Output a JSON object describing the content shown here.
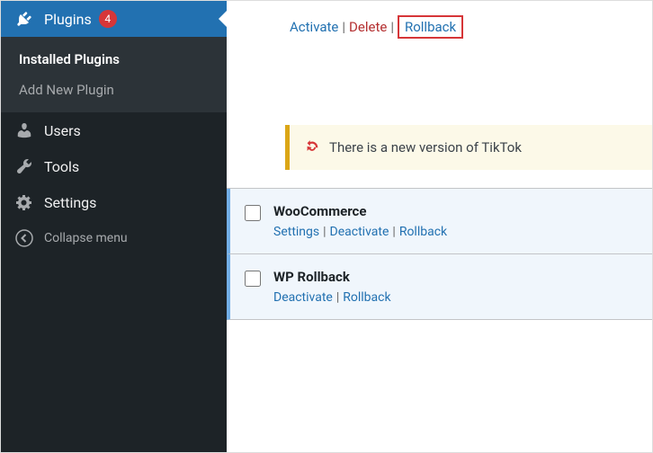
{
  "sidebar": {
    "plugins": {
      "label": "Plugins",
      "badge": "4"
    },
    "submenu": {
      "installed": "Installed Plugins",
      "addnew": "Add New Plugin"
    },
    "users": "Users",
    "tools": "Tools",
    "settings": "Settings",
    "collapse": "Collapse menu"
  },
  "top_links": {
    "activate": "Activate",
    "delete": "Delete",
    "rollback": "Rollback"
  },
  "notice": {
    "text": "There is a new version of TikTok"
  },
  "plugins": [
    {
      "name": "WooCommerce",
      "actions": {
        "settings": "Settings",
        "deactivate": "Deactivate",
        "rollback": "Rollback"
      }
    },
    {
      "name": "WP Rollback",
      "actions": {
        "deactivate": "Deactivate",
        "rollback": "Rollback"
      }
    }
  ]
}
